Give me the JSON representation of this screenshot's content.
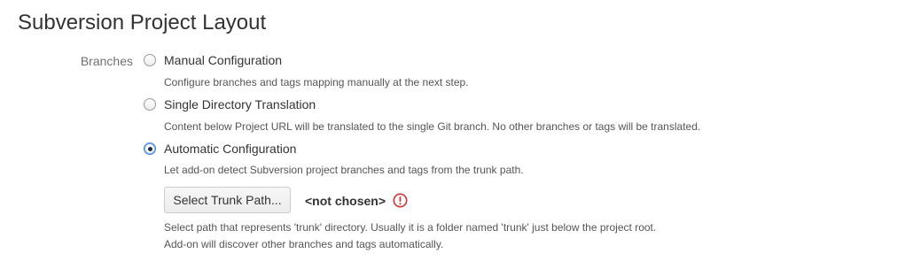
{
  "page": {
    "title": "Subversion Project Layout"
  },
  "branches": {
    "label": "Branches",
    "options": [
      {
        "label": "Manual Configuration",
        "description": "Configure branches and tags mapping manually at the next step.",
        "selected": false
      },
      {
        "label": "Single Directory Translation",
        "description": "Content below Project URL will be translated to the single Git branch. No other branches or tags will be translated.",
        "selected": false
      },
      {
        "label": "Automatic Configuration",
        "description": "Let add-on detect Subversion project branches and tags from the trunk path.",
        "selected": true
      }
    ]
  },
  "trunk": {
    "button_label": "Select Trunk Path...",
    "value": "<not chosen>",
    "status_icon": "error-icon",
    "help_line_1": "Select path that represents 'trunk' directory. Usually it is a folder named 'trunk' just below the project root.",
    "help_line_2": "Add-on will discover other branches and tags automatically."
  },
  "colors": {
    "error": "#d0312d",
    "radio_selected": "#4a88d8"
  }
}
